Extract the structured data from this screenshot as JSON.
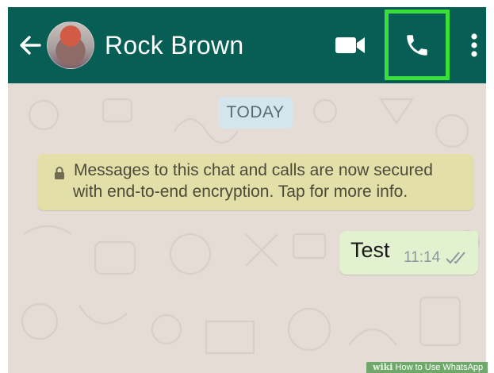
{
  "header": {
    "contact_name": "Rock Brown",
    "background_color": "#075e54",
    "highlight_color": "#39e039",
    "icons": {
      "back": "arrow-left-icon",
      "video": "video-camera-icon",
      "call": "phone-icon",
      "menu": "more-vertical-icon"
    }
  },
  "chat": {
    "wallpaper_color": "#e5ddd5",
    "date_chip": "TODAY",
    "encryption_notice": {
      "icon": "lock-icon",
      "line1": "Messages to this chat and calls are now secured",
      "line2": "with end-to-end encryption. Tap for more info."
    },
    "messages": [
      {
        "direction": "outgoing",
        "text": "Test",
        "time": "11:14",
        "status_icon": "double-check-icon"
      }
    ]
  },
  "watermark": {
    "logo": "wiki",
    "text": "How to Use WhatsApp"
  }
}
